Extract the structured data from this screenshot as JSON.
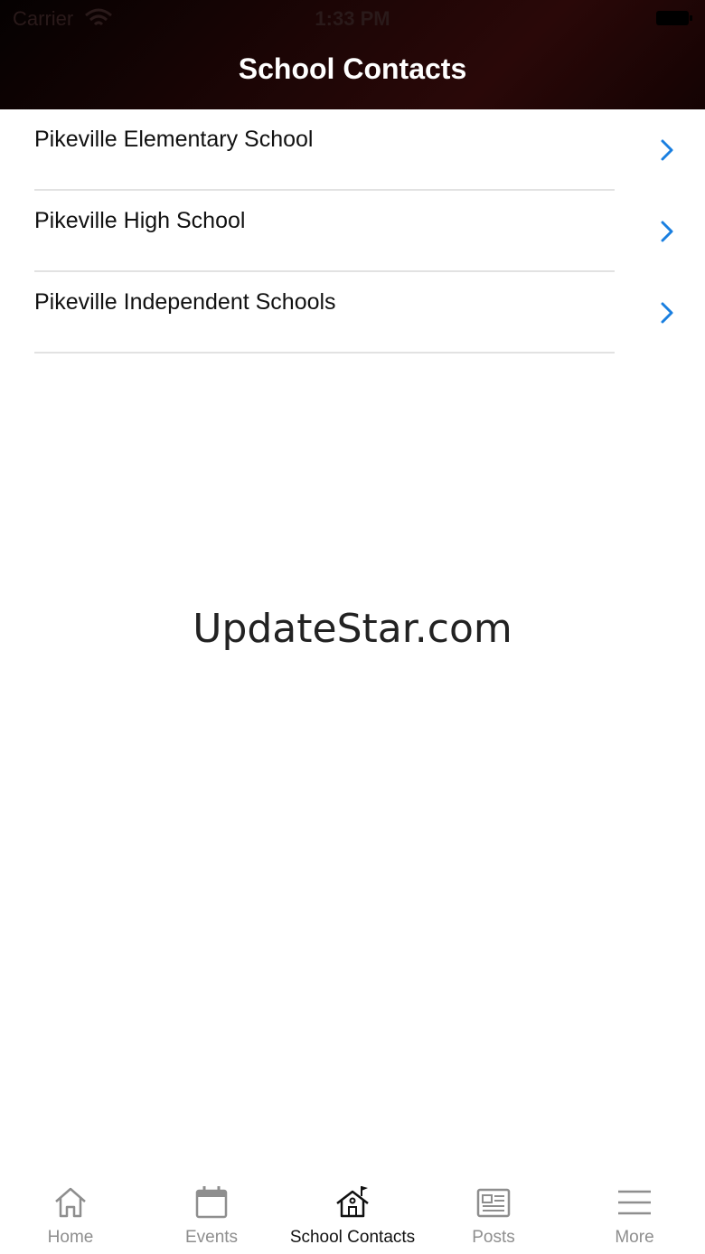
{
  "status_bar": {
    "carrier": "Carrier",
    "time": "1:33 PM"
  },
  "header": {
    "title": "School Contacts"
  },
  "contacts": [
    {
      "label": "Pikeville Elementary School"
    },
    {
      "label": "Pikeville High School"
    },
    {
      "label": "Pikeville Independent Schools"
    }
  ],
  "watermark": "UpdateStar.com",
  "tabs": [
    {
      "label": "Home",
      "icon": "home-icon",
      "active": false
    },
    {
      "label": "Events",
      "icon": "calendar-icon",
      "active": false
    },
    {
      "label": "School Contacts",
      "icon": "school-icon",
      "active": true
    },
    {
      "label": "Posts",
      "icon": "newspaper-icon",
      "active": false
    },
    {
      "label": "More",
      "icon": "menu-icon",
      "active": false
    }
  ],
  "colors": {
    "accent": "#1a7fe0",
    "header_bg": "#1b0505",
    "inactive_tab": "#8e8e8e"
  }
}
